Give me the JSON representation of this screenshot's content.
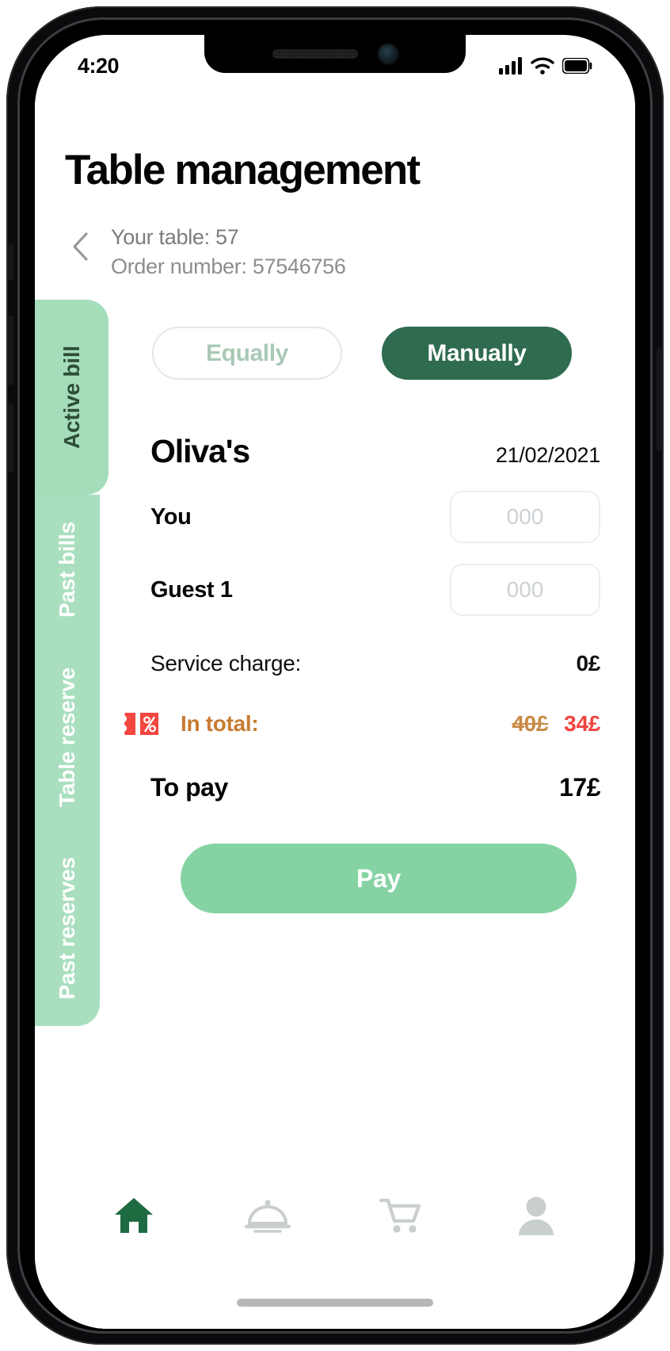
{
  "status_bar": {
    "time": "4:20",
    "signal_icon": "cellular-signal-icon",
    "wifi_icon": "wifi-icon",
    "battery_icon": "battery-full-icon"
  },
  "header": {
    "title": "Table management",
    "back_icon": "chevron-left-icon",
    "table_line": "Your table: 57",
    "order_line": "Order number: 57546756"
  },
  "side_tabs": [
    {
      "label": "Active bill",
      "active": true
    },
    {
      "label": "Past bills",
      "active": false
    },
    {
      "label": "Table reserve",
      "active": false
    },
    {
      "label": "Past reserves",
      "active": false
    }
  ],
  "split_toggle": {
    "equally_label": "Equally",
    "manually_label": "Manually",
    "selected": "Manually"
  },
  "bill": {
    "restaurant": "Oliva's",
    "date": "21/02/2021",
    "payers": [
      {
        "name": "You",
        "value": "",
        "placeholder": "000"
      },
      {
        "name": "Guest 1",
        "value": "",
        "placeholder": "000"
      }
    ],
    "service_charge_label": "Service charge:",
    "service_charge_value": "0£",
    "total_label": "In total:",
    "total_original": "40£",
    "total_discounted": "34£",
    "discount_icon": "discount-percent-ticket-icon",
    "to_pay_label": "To pay",
    "to_pay_value": "17£",
    "pay_button_label": "Pay"
  },
  "bottom_nav": [
    {
      "icon": "home-icon",
      "active": true
    },
    {
      "icon": "room-service-cloche-icon",
      "active": false
    },
    {
      "icon": "shopping-cart-icon",
      "active": false
    },
    {
      "icon": "user-profile-icon",
      "active": false
    }
  ],
  "colors": {
    "mint_sidebar": "#a9dfbf",
    "dark_green": "#2f6b4f",
    "pay_green": "#85d3a3",
    "discount_red": "#f0443f",
    "total_orange": "#c77b32",
    "active_nav": "#1e6b42"
  }
}
